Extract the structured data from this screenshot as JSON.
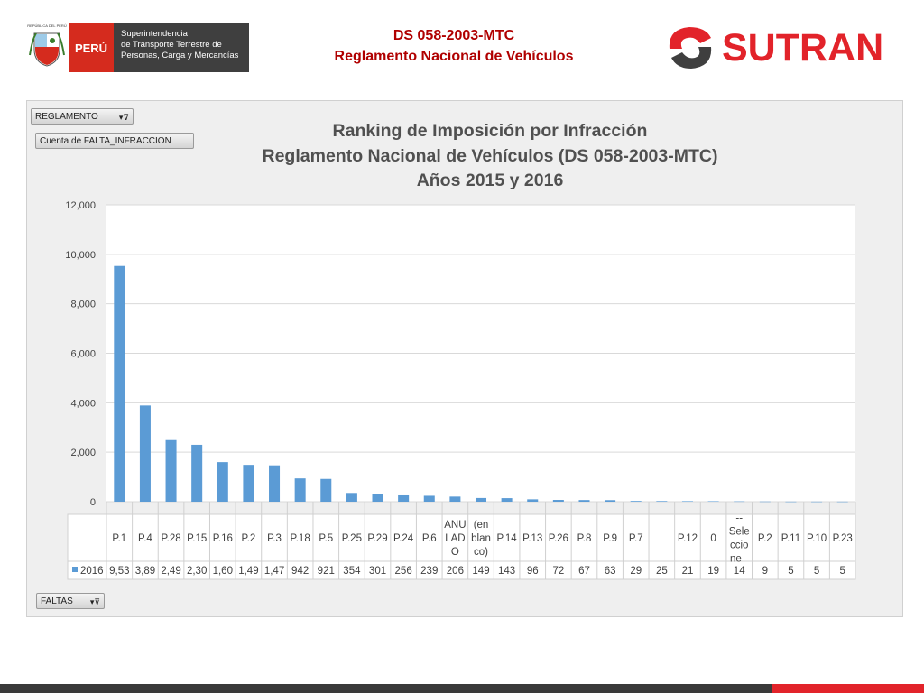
{
  "header": {
    "escudo_text": "REPÚBLICA DEL PERÚ",
    "peru_label": "PERÚ",
    "entity_lines": [
      "Superintendencia",
      "de Transporte Terrestre de",
      "Personas, Carga y Mercancías"
    ],
    "title_line1": "DS 058-2003-MTC",
    "title_line2": "Reglamento Nacional de Vehículos",
    "sutran_label": "SUTRAN"
  },
  "filters": {
    "reglamento": "REGLAMENTO",
    "cuenta": "Cuenta de FALTA_INFRACCION",
    "faltas": "FALTAS"
  },
  "colors": {
    "bar": "#5b9bd5",
    "title_red": "#b00000",
    "sutran_red": "#e2232a"
  },
  "chart_data": {
    "type": "bar",
    "title": [
      "Ranking de Imposición por Infracción",
      "Reglamento Nacional de Vehículos (DS 058-2003-MTC)",
      "Años 2015 y 2016"
    ],
    "categories": [
      "P.1",
      "P.4",
      "P.28",
      "P.15",
      "P.16",
      "P.2",
      "P.3",
      "P.18",
      "P.5",
      "P.25",
      "P.29",
      "P.24",
      "P.6",
      "ANULADO",
      "(en blanco)",
      "P.14",
      "P.13",
      "P.26",
      "P.8",
      "P.9",
      "P.7",
      "",
      "P.12",
      "0",
      "--Seleccione--",
      "P.2",
      "P.11",
      "P.10",
      "P.23"
    ],
    "category_labels": [
      [
        "P.1"
      ],
      [
        "P.4"
      ],
      [
        "P.28"
      ],
      [
        "P.15"
      ],
      [
        "P.16"
      ],
      [
        "P.2"
      ],
      [
        "P.3"
      ],
      [
        "P.18"
      ],
      [
        "P.5"
      ],
      [
        "P.25"
      ],
      [
        "P.29"
      ],
      [
        "P.24"
      ],
      [
        "P.6"
      ],
      [
        "ANU",
        "LAD",
        "O"
      ],
      [
        "(en",
        "blan",
        "co)"
      ],
      [
        "P.14"
      ],
      [
        "P.13"
      ],
      [
        "P.26"
      ],
      [
        "P.8"
      ],
      [
        "P.9"
      ],
      [
        "P.7"
      ],
      [
        ""
      ],
      [
        "P.12"
      ],
      [
        "0"
      ],
      [
        "--",
        "Sele",
        "ccio",
        "ne--"
      ],
      [
        "P.2"
      ],
      [
        "P.11"
      ],
      [
        "P.10"
      ],
      [
        "P.23"
      ]
    ],
    "series": [
      {
        "name": "2016",
        "values": [
          9530,
          3890,
          2490,
          2300,
          1600,
          1490,
          1470,
          942,
          921,
          354,
          301,
          256,
          239,
          206,
          149,
          143,
          96,
          72,
          67,
          63,
          29,
          25,
          21,
          19,
          14,
          9,
          5,
          5,
          5
        ],
        "labels": [
          "9,53",
          "3,89",
          "2,49",
          "2,30",
          "1,60",
          "1,49",
          "1,47",
          "942",
          "921",
          "354",
          "301",
          "256",
          "239",
          "206",
          "149",
          "143",
          "96",
          "72",
          "67",
          "63",
          "29",
          "25",
          "21",
          "19",
          "14",
          "9",
          "5",
          "5",
          "5"
        ]
      }
    ],
    "ylim": [
      0,
      12000
    ],
    "yticks": [
      0,
      2000,
      4000,
      6000,
      8000,
      10000,
      12000
    ],
    "ytick_labels": [
      "0",
      "2,000",
      "4,000",
      "6,000",
      "8,000",
      "10,000",
      "12,000"
    ],
    "grid": true,
    "legend": "data-table"
  }
}
